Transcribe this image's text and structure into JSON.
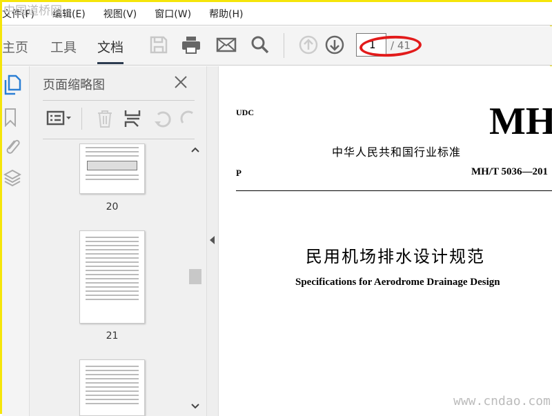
{
  "watermark": {
    "top": "中国道桥网",
    "bottom": "www.cndao.com"
  },
  "menu": [
    "文件(F)",
    "编辑(E)",
    "视图(V)",
    "窗口(W)",
    "帮助(H)"
  ],
  "tabs": [
    "主页",
    "工具",
    "文档"
  ],
  "page_nav": {
    "current": "1",
    "total": "/ 41"
  },
  "panel": {
    "title": "页面缩略图"
  },
  "thumbnails": [
    "20",
    "21",
    ""
  ],
  "document": {
    "udc": "UDC",
    "mh": "MH",
    "industry": "中华人民共和国行业标准",
    "p": "P",
    "code": "MH/T 5036—201",
    "title_cn": "民用机场排水设计规范",
    "title_en": "Specifications for Aerodrome Drainage Design"
  },
  "colors": {
    "accent": "#2b7fd4",
    "annotation": "#e21b1b",
    "border": "#f5e50a"
  }
}
